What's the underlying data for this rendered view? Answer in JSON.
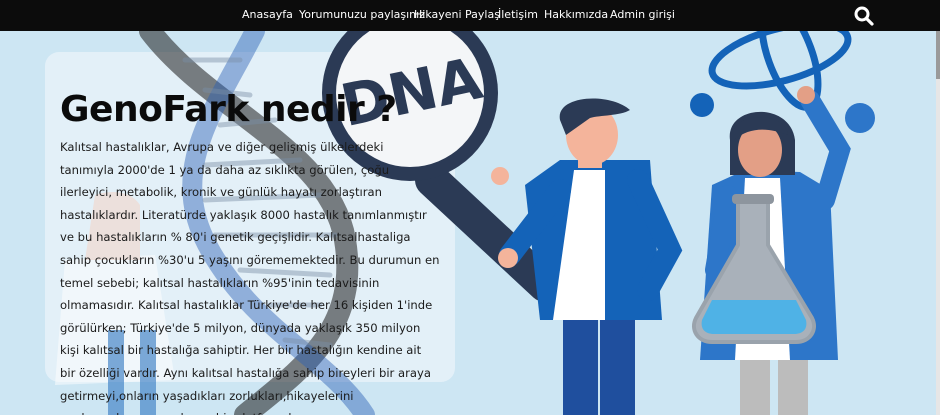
{
  "nav": {
    "items": [
      "Anasayfa",
      "Yorumunuzu paylaşınız",
      "Hikayeni Paylaş",
      "İletişim",
      "Hakkımızda",
      "Admin girişi"
    ]
  },
  "search": {
    "icon": "search-icon"
  },
  "hero": {
    "title": "GenoFark nedir ?",
    "description": "Kalıtsal hastalıklar, Avrupa ve diğer gelişmiş ülkelerdeki tanımıyla 2000'de 1 ya da daha az sıklıkta görülen, çoğu ilerleyici, metabolik, kronik ve günlük hayatı zorlaştıran hastalıklardır. Literatürde yaklaşık 8000 hastalık tanımlanmıştır ve bu hastalıkların % 80'i genetik geçişlidir. Kalıtsalhastaliga sahip çocukların %30'u 5 yaşını görememektedir. Bu durumun en temel sebebi; kalıtsal hastalıkların %95'inin tedavisinin olmamasıdır. Kalıtsal hastalıklar Türkiye'de her 16 kişiden 1'inde görülürken; Türkiye'de 5 milyon, dünyada yaklaşık 350 milyon kişi kalıtsal bir hastalığa sahiptir. Her bir hastalığın kendine ait bir özelliği vardır. Aynı kalıtsal hastalığa sahip bireyleri bir araya getirmeyi,onların yaşadıkları zorlukları,hikayelerini paylaşmalarını amaçlayan bir platformdur.",
    "magnifier_text": "DNA"
  },
  "colors": {
    "nav_bg": "#0c0c0c",
    "hero_bg": "#cde6f3",
    "accent_blue": "#1463b8",
    "dark_navy": "#2b3a55"
  }
}
